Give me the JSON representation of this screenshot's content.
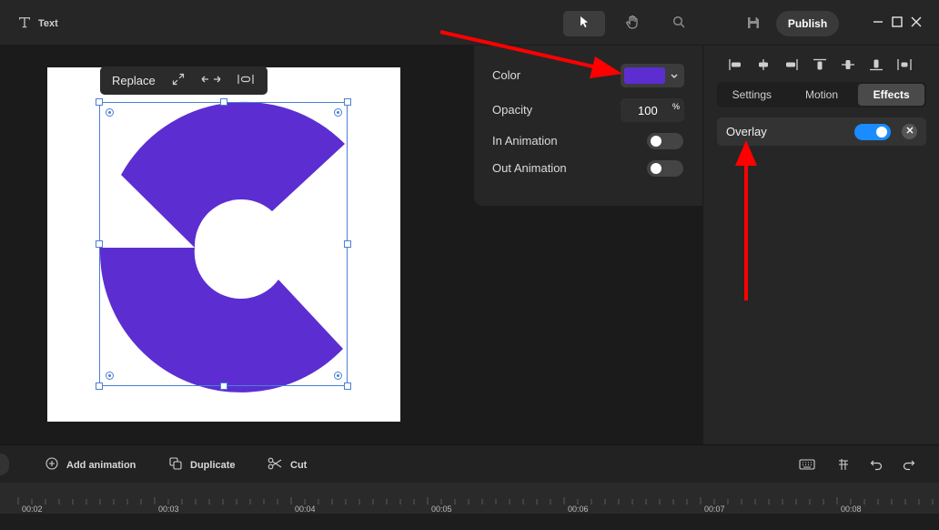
{
  "app": {
    "title": "Text"
  },
  "toolbar": {
    "tools": [
      "select-tool",
      "hand-tool",
      "zoom-tool"
    ],
    "active_tool": "select-tool",
    "publish_label": "Publish"
  },
  "context_toolbar": {
    "replace_label": "Replace"
  },
  "properties": {
    "color_label": "Color",
    "color_value": "#5c2ed1",
    "opacity_label": "Opacity",
    "opacity_value": "100",
    "opacity_unit": "%",
    "in_animation_label": "In Animation",
    "in_animation_on": false,
    "out_animation_label": "Out Animation",
    "out_animation_on": false
  },
  "right_panel": {
    "tabs": [
      {
        "label": "Settings",
        "active": false
      },
      {
        "label": "Motion",
        "active": false
      },
      {
        "label": "Effects",
        "active": true
      }
    ],
    "overlay_label": "Overlay",
    "overlay_on": true
  },
  "bottom_bar": {
    "add_animation_label": "Add animation",
    "duplicate_label": "Duplicate",
    "cut_label": "Cut"
  },
  "timeline": {
    "ticks": [
      "00:02",
      "00:03",
      "00:04",
      "00:05",
      "00:06",
      "00:07",
      "00:08"
    ]
  },
  "colors": {
    "accent": "#5c2ed1",
    "toggle_on": "#1a8cff",
    "annotation_arrow": "#ff0000"
  }
}
